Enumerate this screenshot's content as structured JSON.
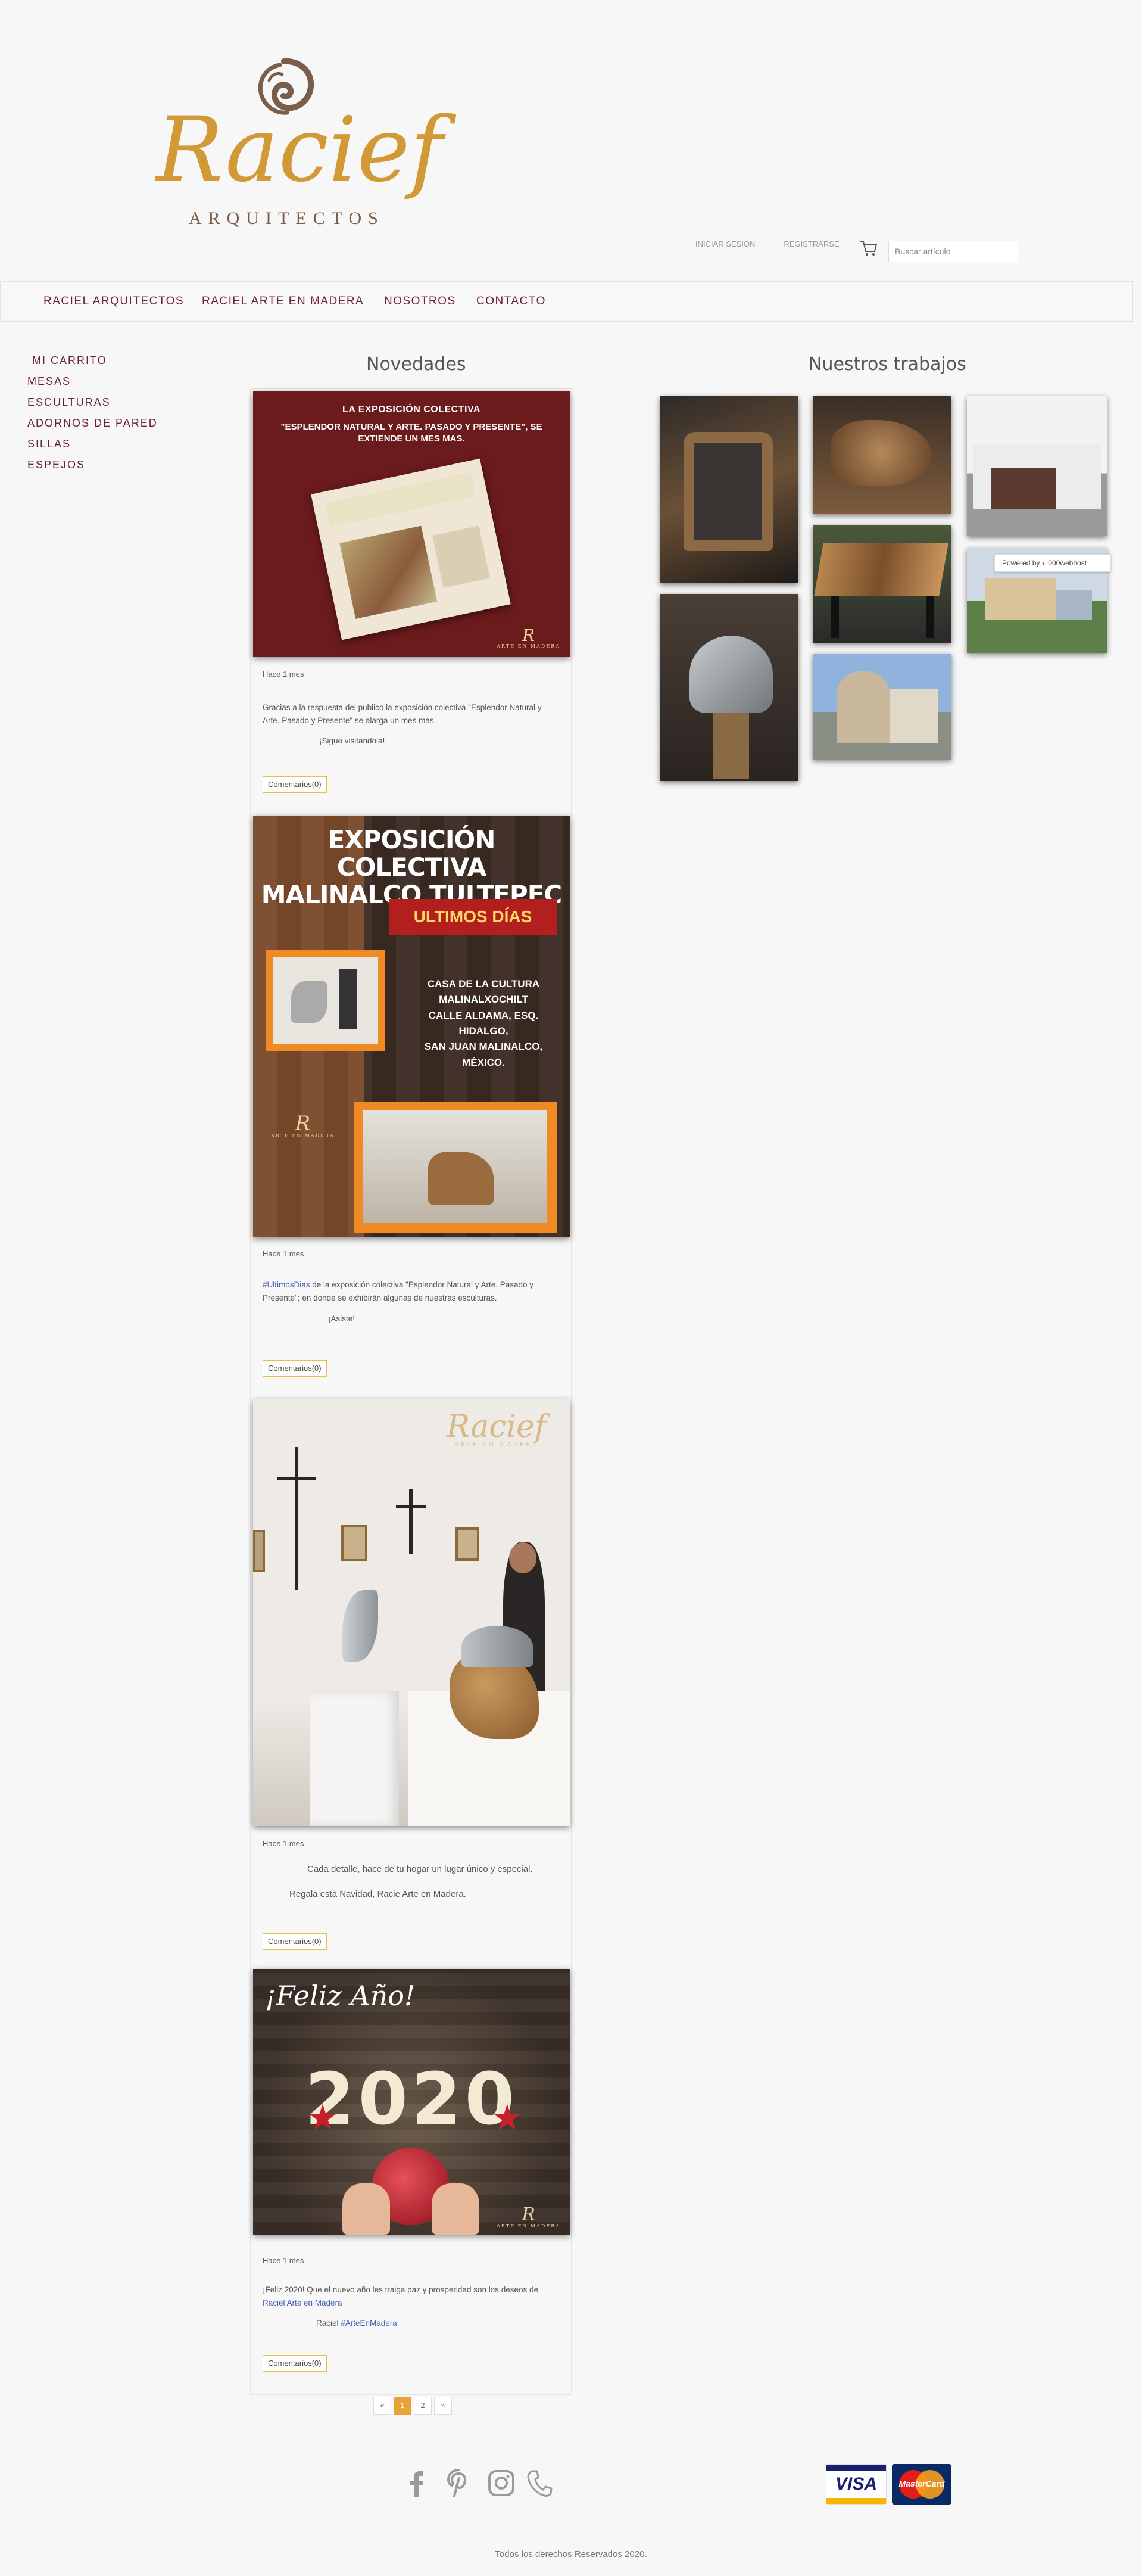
{
  "brand": {
    "logo_word": "Racief",
    "logo_sub": "ARQUITECTOS"
  },
  "header": {
    "login_label": "INICIAR SESION",
    "register_label": "REGISTRARSE",
    "search_placeholder": "Buscar artículo"
  },
  "nav": {
    "items": [
      "RACIEL ARQUITECTOS",
      "RACIEL ARTE EN MADERA",
      "NOSOTROS",
      "CONTACTO"
    ]
  },
  "sidebar": {
    "items": [
      "MI CARRITO",
      "MESAS",
      "ESCULTURAS",
      "ADORNOS DE PARED",
      "SILLAS",
      "ESPEJOS"
    ]
  },
  "novedades": {
    "title": "Novedades",
    "posts": [
      {
        "image_texts": {
          "heading1": "LA EXPOSICIÓN COLECTIVA",
          "heading2": "\"ESPLENDOR NATURAL Y ARTE. PASADO Y PRESENTE\", SE EXTIENDE UN MES MAS.",
          "badge": "ARTE EN MADERA"
        },
        "time": "Hace 1 mes",
        "text1": "Gracias a la respuesta del publico la exposición colectiva \"Esplendor Natural y Arte. Pasado y Presente\" se alarga un mes mas.",
        "text2": "¡Sigue visitandola!",
        "comments": "Comentarios(0)"
      },
      {
        "image_texts": {
          "title1": "EXPOSICIÓN COLECTIVA",
          "title2": "MALINALCO TULTEPEC",
          "banner": "ULTIMOS DÍAS",
          "line1": "CASA DE LA CULTURA",
          "line2": "MALINALXOCHILT",
          "line3": "CALLE ALDAMA, ESQ. HIDALGO,",
          "line4": "SAN JUAN MALINALCO, MÉXICO.",
          "badge": "ARTE EN MADERA"
        },
        "time": "Hace 1 mes",
        "hashtag": "#UltimosDias",
        "text1": " de la exposición colectiva \"Esplendor Natural y Arte. Pasado y Presente\"; en donde se exhibirán algunas de nuestras esculturas.",
        "text2": "¡Asiste!",
        "comments": "Comentarios(0)"
      },
      {
        "image_texts": {
          "badge": "ARTE EN MADERA"
        },
        "time": "Hace 1 mes",
        "text1": "Cada detalle, hace de tu hogar un lugar único y especial.",
        "text2": "Regala esta Navidad, Racie Arte en Madera.",
        "comments": "Comentarios(0)"
      },
      {
        "image_texts": {
          "greeting": "¡Feliz Año!",
          "year": "2020",
          "badge": "ARTE EN MADERA"
        },
        "time": "Hace 1 mes",
        "text1": "¡Feliz 2020! Que el nuevo año les traiga paz y prosperidad son los deseos de ",
        "link1": "Raciel Arte en Madera",
        "text2_prefix": "Raciel ",
        "link2": "#ArteEnMadera",
        "comments": "Comentarios(0)"
      }
    ]
  },
  "pagination": [
    "«",
    "1",
    "2",
    "»"
  ],
  "trabajos": {
    "title": "Nuestros trabajos",
    "powered_prefix": "Powered by",
    "powered_brand": "000webhost"
  },
  "footer": {
    "social_icons": [
      "facebook-icon",
      "pinterest-icon",
      "instagram-icon",
      "phone-icon"
    ],
    "cards": [
      "VISA",
      "MasterCard"
    ],
    "copyright": "Todos los derechos Reservados 2020."
  },
  "colors": {
    "accent": "#d19a36",
    "nav_text": "#6b2230",
    "active_page": "#e8a43b",
    "link": "#4a62b5"
  }
}
